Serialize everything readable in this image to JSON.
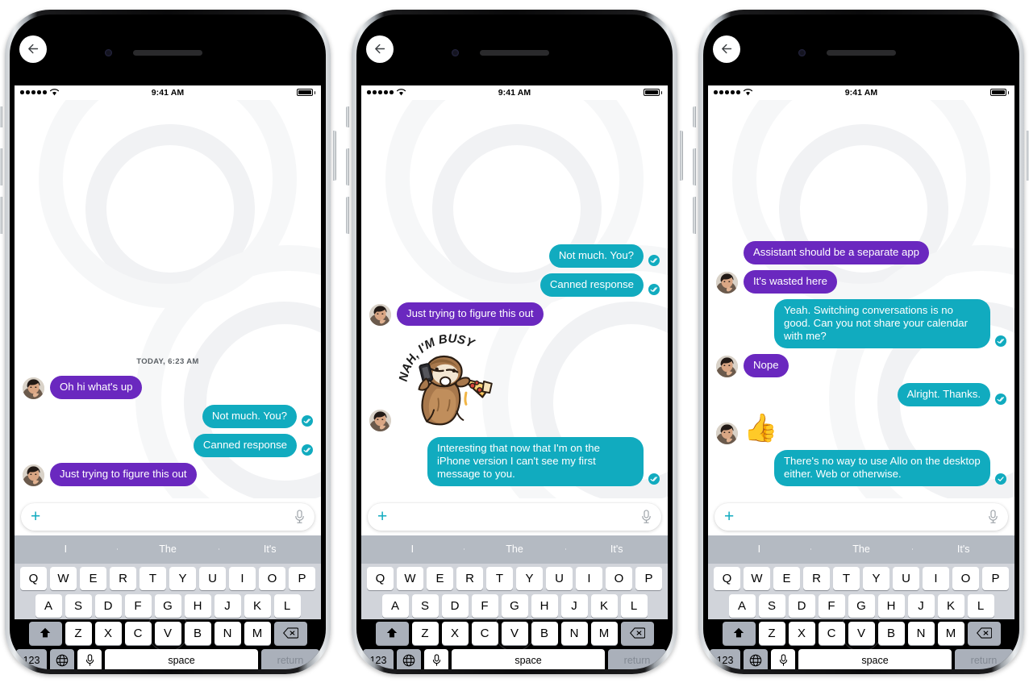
{
  "app": "Google Allo",
  "status_bar": {
    "time": "9:41 AM",
    "signal_dots": 5,
    "wifi": "wifi-icon",
    "battery": "battery-full-icon"
  },
  "composer": {
    "attach_label": "+",
    "mic": "microphone-icon",
    "placeholder": ""
  },
  "keyboard": {
    "predictions": [
      "I",
      "The",
      "It's"
    ],
    "row1": [
      "Q",
      "W",
      "E",
      "R",
      "T",
      "Y",
      "U",
      "I",
      "O",
      "P"
    ],
    "row2": [
      "A",
      "S",
      "D",
      "F",
      "G",
      "H",
      "J",
      "K",
      "L"
    ],
    "row3": [
      "Z",
      "X",
      "C",
      "V",
      "B",
      "N",
      "M"
    ],
    "shift": "shift-icon",
    "delete": "backspace-icon",
    "numbers": "123",
    "globe": "globe-icon",
    "dictate": "microphone-icon",
    "space": "space",
    "return": "return"
  },
  "back_button": "back-arrow-icon",
  "phones": [
    {
      "id": "phone-left",
      "daystamp": "TODAY, 6:23 AM",
      "messages": [
        {
          "side": "in",
          "type": "text",
          "text": "Oh hi what's up",
          "avatar": true,
          "receipt": null
        },
        {
          "side": "out",
          "type": "text",
          "text": "Not much. You?",
          "avatar": false,
          "receipt": "read"
        },
        {
          "side": "out",
          "type": "text",
          "text": "Canned response",
          "avatar": false,
          "receipt": "read"
        },
        {
          "side": "in",
          "type": "text",
          "text": "Just trying to figure this out",
          "avatar": true,
          "receipt": null
        }
      ]
    },
    {
      "id": "phone-center",
      "daystamp": null,
      "messages": [
        {
          "side": "out",
          "type": "text",
          "text": "Not much. You?",
          "avatar": false,
          "receipt": "read"
        },
        {
          "side": "out",
          "type": "text",
          "text": "Canned response",
          "avatar": false,
          "receipt": "read"
        },
        {
          "side": "in",
          "type": "text",
          "text": "Just trying to figure this out",
          "avatar": true,
          "receipt": null
        },
        {
          "side": "in",
          "type": "sticker",
          "sticker_caption": "NAH, I'M BUSY",
          "sticker_name": "sloth-with-pizza-and-phone-sticker",
          "avatar": true,
          "receipt": null
        },
        {
          "side": "out",
          "type": "text",
          "text": "Interesting that now that I'm on the iPhone version I can't see my first message to you.",
          "avatar": false,
          "receipt": "read"
        }
      ]
    },
    {
      "id": "phone-right",
      "daystamp": null,
      "messages": [
        {
          "side": "in",
          "type": "text",
          "text": "Assistant should be a separate app",
          "avatar": false,
          "receipt": null
        },
        {
          "side": "in",
          "type": "text",
          "text": "It's wasted here",
          "avatar": true,
          "receipt": null
        },
        {
          "side": "out",
          "type": "text",
          "text": "Yeah. Switching conversations is no good. Can you not share your calendar with me?",
          "avatar": false,
          "receipt": "read"
        },
        {
          "side": "in",
          "type": "text",
          "text": "Nope",
          "avatar": true,
          "receipt": null
        },
        {
          "side": "out",
          "type": "text",
          "text": "Alright. Thanks.",
          "avatar": false,
          "receipt": "read"
        },
        {
          "side": "in",
          "type": "emoji",
          "text": "👍",
          "avatar": true,
          "receipt": null
        },
        {
          "side": "out",
          "type": "text",
          "text": "There's no way to use Allo on the desktop either. Web or otherwise.",
          "avatar": false,
          "receipt": "delivered"
        }
      ]
    }
  ],
  "colors": {
    "incoming_bubble": "#6a28bf",
    "outgoing_bubble": "#11abbf",
    "accent": "#11abbf",
    "keyboard_bg": "#d1d4da",
    "prediction_bar": "#b4bac2",
    "screen_bg": "#ffffff"
  }
}
